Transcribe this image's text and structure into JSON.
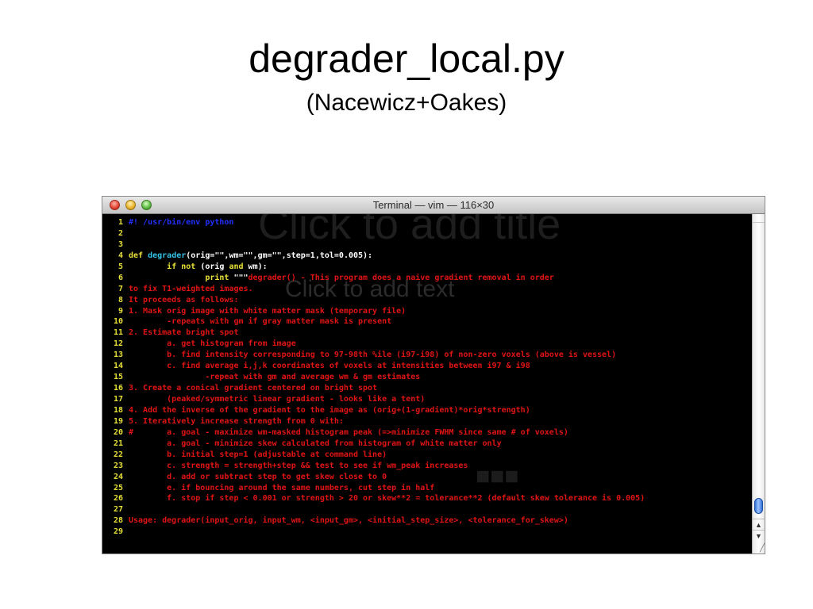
{
  "slide": {
    "title": "degrader_local.py",
    "subtitle": "(Nacewicz+Oakes)"
  },
  "window": {
    "title": "Terminal — vim — 116×30",
    "controls": [
      "close",
      "minimize",
      "zoom"
    ],
    "ghost_text": [
      "Click to add title",
      "Click to add text",
      "■■■"
    ]
  },
  "terminal": {
    "lines": [
      {
        "n": "1",
        "parts": [
          {
            "c": "comment",
            "t": "#! /usr/bin/env python"
          }
        ]
      },
      {
        "n": "2",
        "parts": []
      },
      {
        "n": "3",
        "parts": []
      },
      {
        "n": "4",
        "parts": [
          {
            "c": "kw",
            "t": "def "
          },
          {
            "c": "fn",
            "t": "degrader"
          },
          {
            "c": "txt",
            "t": "(orig=\"\",wm=\"\",gm=\"\",step=1,tol=0.005):"
          }
        ]
      },
      {
        "n": "5",
        "parts": [
          {
            "c": "txt",
            "t": "        "
          },
          {
            "c": "kw",
            "t": "if not "
          },
          {
            "c": "txt",
            "t": "(orig "
          },
          {
            "c": "kw",
            "t": "and "
          },
          {
            "c": "txt",
            "t": "wm):"
          }
        ]
      },
      {
        "n": "6",
        "parts": [
          {
            "c": "txt",
            "t": "                "
          },
          {
            "c": "kw",
            "t": "print "
          },
          {
            "c": "txt",
            "t": "\"\"\""
          },
          {
            "c": "red",
            "t": "degrader() - This program does a naive gradient removal in order"
          }
        ]
      },
      {
        "n": "7",
        "parts": [
          {
            "c": "red",
            "t": "to fix T1-weighted images."
          }
        ]
      },
      {
        "n": "8",
        "parts": [
          {
            "c": "red",
            "t": "It proceeds as follows:"
          }
        ]
      },
      {
        "n": "9",
        "parts": [
          {
            "c": "red",
            "t": "1. Mask orig image with white matter mask (temporary file)"
          }
        ]
      },
      {
        "n": "10",
        "parts": [
          {
            "c": "red",
            "t": "        -repeats with gm if gray matter mask is present"
          }
        ]
      },
      {
        "n": "11",
        "parts": [
          {
            "c": "red",
            "t": "2. Estimate bright spot"
          }
        ]
      },
      {
        "n": "12",
        "parts": [
          {
            "c": "red",
            "t": "        a. get histogram from image"
          }
        ]
      },
      {
        "n": "13",
        "parts": [
          {
            "c": "red",
            "t": "        b. find intensity corresponding to 97-98th %ile (i97-i98) of non-zero voxels (above is vessel)"
          }
        ]
      },
      {
        "n": "14",
        "parts": [
          {
            "c": "red",
            "t": "        c. find average i,j,k coordinates of voxels at intensities between i97 & i98"
          }
        ]
      },
      {
        "n": "15",
        "parts": [
          {
            "c": "red",
            "t": "                -repeat with gm and average wm & gm estimates"
          }
        ]
      },
      {
        "n": "16",
        "parts": [
          {
            "c": "red",
            "t": "3. Create a conical gradient centered on bright spot"
          }
        ]
      },
      {
        "n": "17",
        "parts": [
          {
            "c": "red",
            "t": "        (peaked/symmetric linear gradient - looks like a tent)"
          }
        ]
      },
      {
        "n": "18",
        "parts": [
          {
            "c": "red",
            "t": "4. Add the inverse of the gradient to the image as (orig+(1-gradient)*orig*strength)"
          }
        ]
      },
      {
        "n": "19",
        "parts": [
          {
            "c": "red",
            "t": "5. Iteratively increase strength from 0 with:"
          }
        ]
      },
      {
        "n": "20",
        "parts": [
          {
            "c": "red",
            "t": "#       a. goal - maximize wm-masked histogram peak (=>minimize FWHM since same # of voxels)"
          }
        ]
      },
      {
        "n": "21",
        "parts": [
          {
            "c": "red",
            "t": "        a. goal - minimize skew calculated from histogram of white matter only"
          }
        ]
      },
      {
        "n": "22",
        "parts": [
          {
            "c": "red",
            "t": "        b. initial step=1 (adjustable at command line)"
          }
        ]
      },
      {
        "n": "23",
        "parts": [
          {
            "c": "red",
            "t": "        c. strength = strength+step && test to see if wm_peak increases"
          }
        ]
      },
      {
        "n": "24",
        "parts": [
          {
            "c": "red",
            "t": "        d. add or subtract step to get skew close to 0"
          }
        ]
      },
      {
        "n": "25",
        "parts": [
          {
            "c": "red",
            "t": "        e. if bouncing around the same numbers, cut step in half"
          }
        ]
      },
      {
        "n": "26",
        "parts": [
          {
            "c": "red",
            "t": "        f. stop if step < 0.001 or strength > 20 or skew**2 = tolerance**2 (default skew tolerance is 0.005)"
          }
        ]
      },
      {
        "n": "27",
        "parts": []
      },
      {
        "n": "28",
        "parts": [
          {
            "c": "red",
            "t": "Usage: degrader(input_orig, input_wm, <input_gm>, <initial_step_size>, <tolerance_for_skew>)"
          }
        ]
      },
      {
        "n": "29",
        "parts": []
      }
    ]
  },
  "scrollbar": {
    "up_arrow": "▲",
    "down_arrow": "▼",
    "resize_grip": "╱"
  },
  "colors": {
    "comment": "#2130ff",
    "keyword": "#e7e038",
    "function": "#35c2e6",
    "string": "#e11414",
    "line_number": "#e7e038",
    "background": "#000000"
  }
}
